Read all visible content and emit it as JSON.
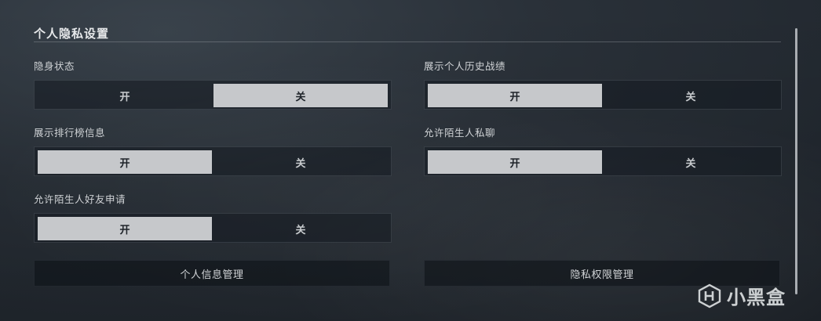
{
  "panel": {
    "title": "个人隐私设置"
  },
  "settings": [
    {
      "label": "隐身状态",
      "on_label": "开",
      "off_label": "关",
      "value": "关"
    },
    {
      "label": "展示个人历史战绩",
      "on_label": "开",
      "off_label": "关",
      "value": "开"
    },
    {
      "label": "展示排行榜信息",
      "on_label": "开",
      "off_label": "关",
      "value": "开"
    },
    {
      "label": "允许陌生人私聊",
      "on_label": "开",
      "off_label": "关",
      "value": "开"
    },
    {
      "label": "允许陌生人好友申请",
      "on_label": "开",
      "off_label": "关",
      "value": "开"
    }
  ],
  "buttons": {
    "personal_info": "个人信息管理",
    "privacy_permissions": "隐私权限管理"
  },
  "watermark": {
    "text": "小黑盒",
    "icon": "heybox-logo-icon"
  },
  "colors": {
    "selected_bg": "#c6c8cb",
    "panel_bg": "#2a3139"
  }
}
